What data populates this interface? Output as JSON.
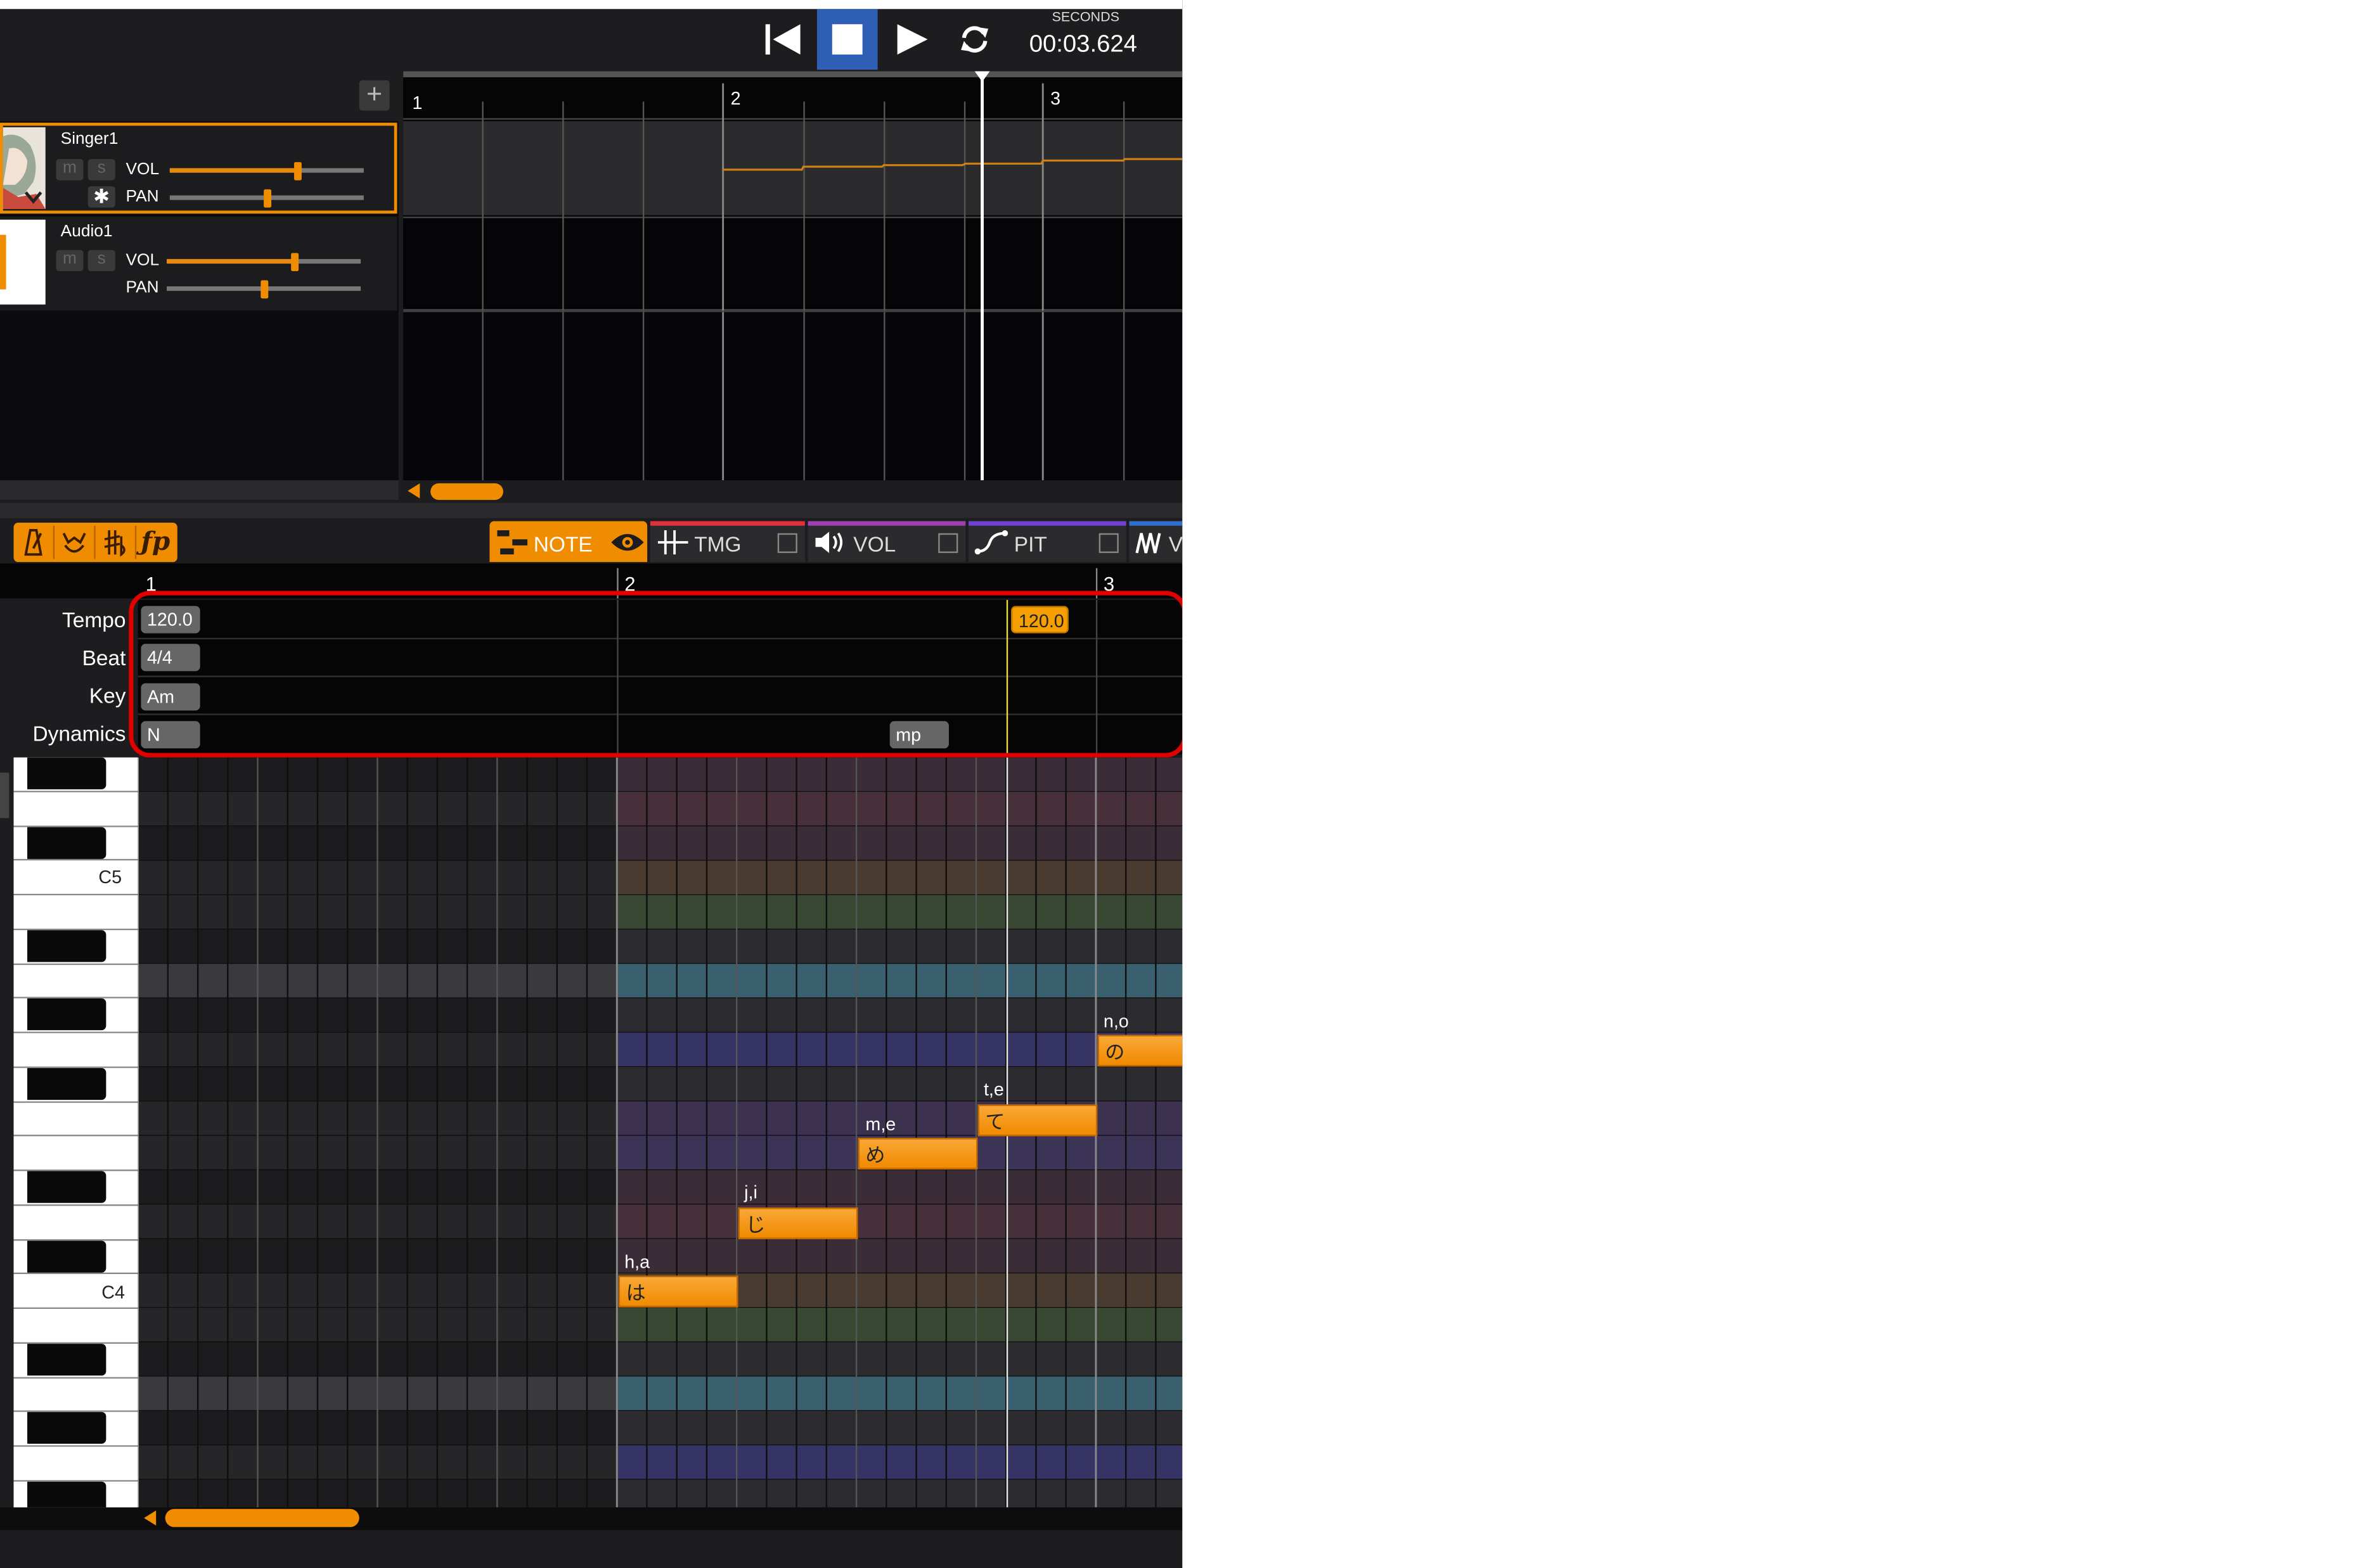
{
  "transport": {
    "seconds_label": "SECONDS",
    "time": "00:03.624",
    "buttons": [
      "rewind",
      "stop",
      "play",
      "loop"
    ]
  },
  "tracks": [
    {
      "name": "Singer1",
      "m": "m",
      "s": "s",
      "vol_label": "VOL",
      "pan_label": "PAN",
      "vol_level": 0.66,
      "pan_level": 0.5,
      "selected": true
    },
    {
      "name": "Audio1",
      "m": "m",
      "s": "s",
      "vol_label": "VOL",
      "pan_label": "PAN",
      "vol_level": 0.66,
      "pan_level": 0.5,
      "selected": false
    }
  ],
  "add_track_label": "+",
  "overview_ruler": [
    "1",
    "2",
    "3"
  ],
  "editor": {
    "tool_icons": [
      "metronome-icon",
      "conductor-icon",
      "key-signature-icon",
      "dynamics-icon"
    ],
    "tabs": [
      {
        "label": "NOTE",
        "color": "#f08c00",
        "active": true
      },
      {
        "label": "TMG",
        "color": "#e0303c",
        "active": false
      },
      {
        "label": "VOL",
        "color": "#a040b0",
        "active": false
      },
      {
        "label": "PIT",
        "color": "#7040d0",
        "active": false
      },
      {
        "label": "V",
        "color": "#3070d0",
        "active": false
      }
    ],
    "ruler": [
      "1",
      "2",
      "3"
    ],
    "header_rows": {
      "tempo": {
        "label": "Tempo",
        "values": [
          "120.0",
          "120.0"
        ]
      },
      "beat": {
        "label": "Beat",
        "value": "4/4"
      },
      "key": {
        "label": "Key",
        "value": "Am"
      },
      "dynamics": {
        "label": "Dynamics",
        "values": [
          "N",
          "mp"
        ]
      }
    },
    "key_labels": [
      "C5",
      "C4"
    ],
    "notes": [
      {
        "lyric": "は",
        "phoneme": "h,a"
      },
      {
        "lyric": "じ",
        "phoneme": "j,i"
      },
      {
        "lyric": "め",
        "phoneme": "m,e"
      },
      {
        "lyric": "て",
        "phoneme": "t,e"
      },
      {
        "lyric": "の",
        "phoneme": "n,o"
      }
    ]
  },
  "colors": {
    "accent": "#f08c00",
    "highlight": "#e00000",
    "background": "#1d1d1f"
  }
}
